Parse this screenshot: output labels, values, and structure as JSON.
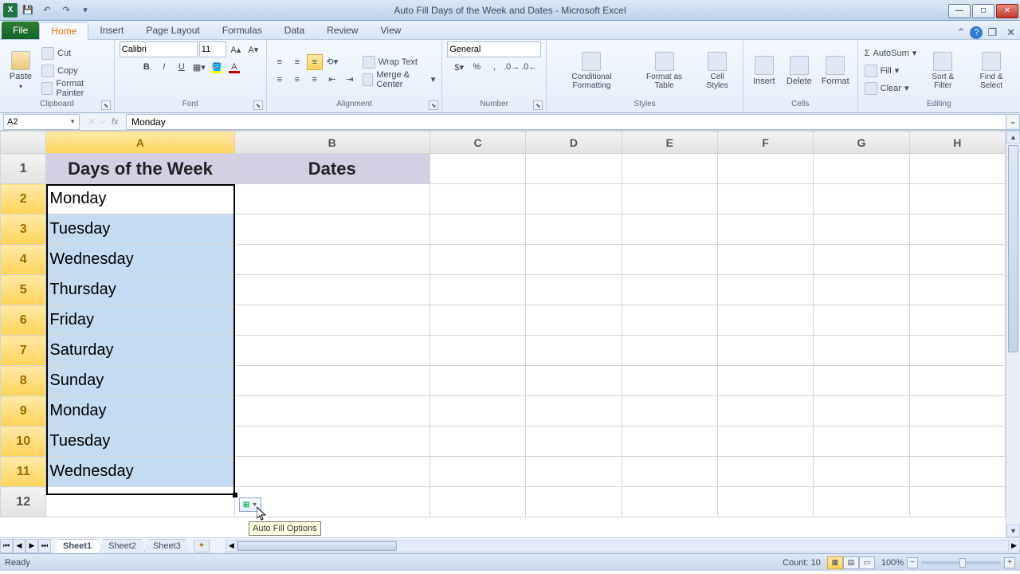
{
  "app": {
    "title_doc": "Auto Fill Days of the Week and Dates",
    "title_app": "Microsoft Excel"
  },
  "ribbon": {
    "file": "File",
    "tabs": [
      "Home",
      "Insert",
      "Page Layout",
      "Formulas",
      "Data",
      "Review",
      "View"
    ],
    "active_tab": "Home",
    "clipboard": {
      "paste": "Paste",
      "cut": "Cut",
      "copy": "Copy",
      "format_painter": "Format Painter",
      "label": "Clipboard"
    },
    "font": {
      "name": "Calibri",
      "size": "11",
      "label": "Font"
    },
    "alignment": {
      "wrap": "Wrap Text",
      "merge": "Merge & Center",
      "label": "Alignment"
    },
    "number": {
      "format": "General",
      "label": "Number"
    },
    "styles": {
      "cond": "Conditional Formatting",
      "table": "Format as Table",
      "cell": "Cell Styles",
      "label": "Styles"
    },
    "cells": {
      "insert": "Insert",
      "delete": "Delete",
      "format": "Format",
      "label": "Cells"
    },
    "editing": {
      "autosum": "AutoSum",
      "fill": "Fill",
      "clear": "Clear",
      "sort": "Sort & Filter",
      "find": "Find & Select",
      "label": "Editing"
    }
  },
  "formula_bar": {
    "name_box": "A2",
    "value": "Monday"
  },
  "columns": [
    "A",
    "B",
    "C",
    "D",
    "E",
    "F",
    "G",
    "H"
  ],
  "headers": {
    "A": "Days of the Week",
    "B": "Dates"
  },
  "rows": [
    {
      "n": 1
    },
    {
      "n": 2,
      "A": "Monday"
    },
    {
      "n": 3,
      "A": "Tuesday"
    },
    {
      "n": 4,
      "A": "Wednesday"
    },
    {
      "n": 5,
      "A": "Thursday"
    },
    {
      "n": 6,
      "A": "Friday"
    },
    {
      "n": 7,
      "A": "Saturday"
    },
    {
      "n": 8,
      "A": "Sunday"
    },
    {
      "n": 9,
      "A": "Monday"
    },
    {
      "n": 10,
      "A": "Tuesday"
    },
    {
      "n": 11,
      "A": "Wednesday"
    },
    {
      "n": 12
    }
  ],
  "autofill_tooltip": "Auto Fill Options",
  "sheets": {
    "tabs": [
      "Sheet1",
      "Sheet2",
      "Sheet3"
    ],
    "active": "Sheet1"
  },
  "status": {
    "ready": "Ready",
    "count_label": "Count:",
    "count": "10",
    "zoom": "100%"
  }
}
